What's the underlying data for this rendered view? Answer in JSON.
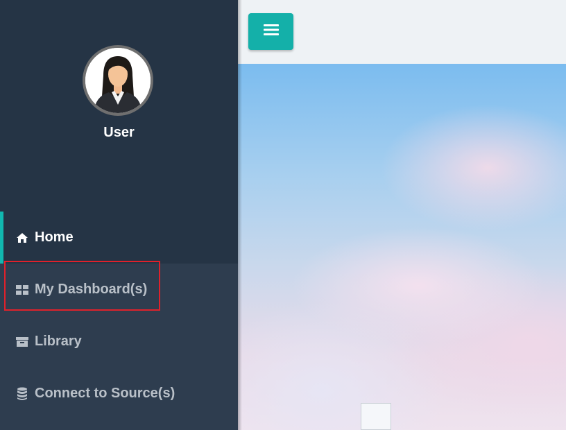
{
  "profile": {
    "username": "User"
  },
  "nav": {
    "home": "Home",
    "dashboards": "My Dashboard(s)",
    "library": "Library",
    "connect": "Connect to Source(s)"
  },
  "colors": {
    "sidebar": "#2e3d4f",
    "sidebar_dark": "#253445",
    "accent": "#11b8b0",
    "highlight": "#e0212b"
  }
}
